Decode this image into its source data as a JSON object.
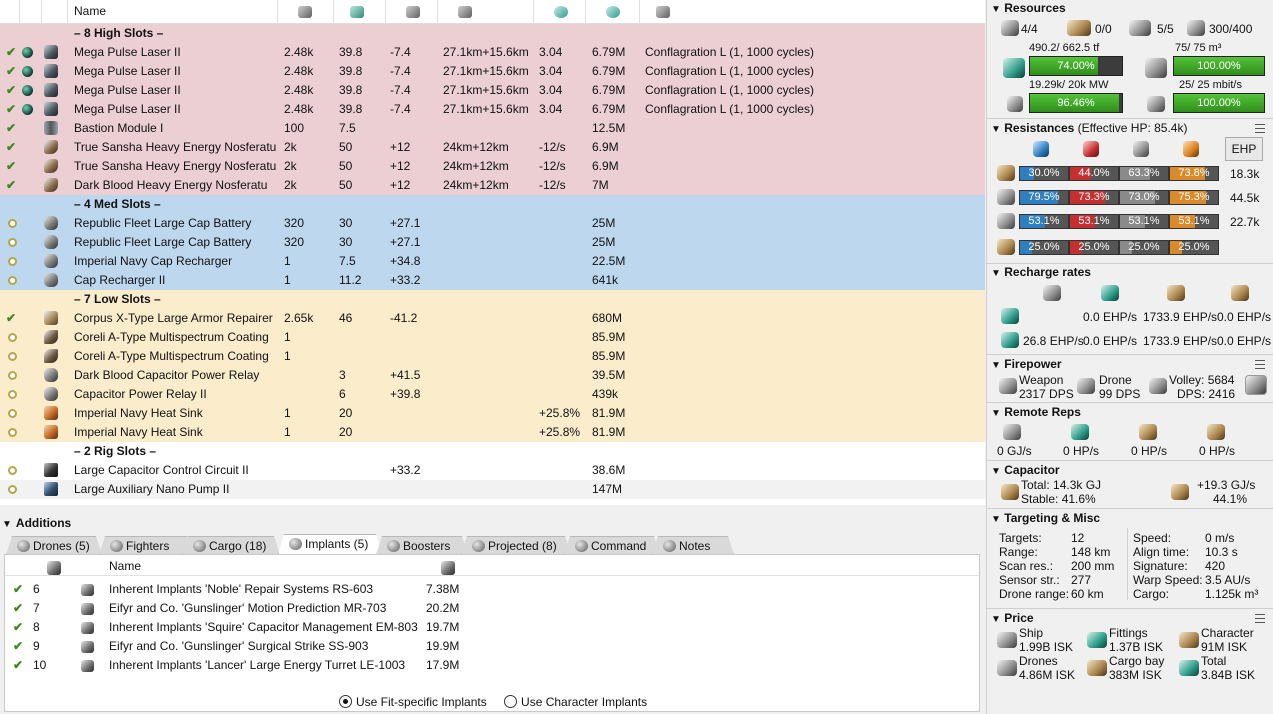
{
  "fitting": {
    "name_header": "Name",
    "sections": {
      "high": "– 8 High Slots –",
      "med": "– 4 Med Slots –",
      "low": "– 7 Low Slots –",
      "rig": "– 2 Rig Slots –"
    },
    "rows": [
      {
        "name": "Mega Pulse Laser II",
        "cpu": "2.48k",
        "pg": "39.8",
        "cap": "-7.4",
        "range": "27.1km+15.6km",
        "dps": "3.04",
        "price": "6.79M",
        "ammo": "Conflagration L (1, 1000 cycles)"
      },
      {
        "name": "Mega Pulse Laser II",
        "cpu": "2.48k",
        "pg": "39.8",
        "cap": "-7.4",
        "range": "27.1km+15.6km",
        "dps": "3.04",
        "price": "6.79M",
        "ammo": "Conflagration L (1, 1000 cycles)"
      },
      {
        "name": "Mega Pulse Laser II",
        "cpu": "2.48k",
        "pg": "39.8",
        "cap": "-7.4",
        "range": "27.1km+15.6km",
        "dps": "3.04",
        "price": "6.79M",
        "ammo": "Conflagration L (1, 1000 cycles)"
      },
      {
        "name": "Mega Pulse Laser II",
        "cpu": "2.48k",
        "pg": "39.8",
        "cap": "-7.4",
        "range": "27.1km+15.6km",
        "dps": "3.04",
        "price": "6.79M",
        "ammo": "Conflagration L (1, 1000 cycles)"
      },
      {
        "name": "Bastion Module I",
        "cpu": "100",
        "pg": "7.5",
        "cap": "",
        "range": "",
        "dps": "",
        "price": "12.5M",
        "ammo": ""
      },
      {
        "name": "True Sansha Heavy Energy Nosferatu",
        "cpu": "2k",
        "pg": "50",
        "cap": "+12",
        "range": "24km+12km",
        "dps": "-12/s",
        "price": "6.9M",
        "ammo": ""
      },
      {
        "name": "True Sansha Heavy Energy Nosferatu",
        "cpu": "2k",
        "pg": "50",
        "cap": "+12",
        "range": "24km+12km",
        "dps": "-12/s",
        "price": "6.9M",
        "ammo": ""
      },
      {
        "name": "Dark Blood Heavy Energy Nosferatu",
        "cpu": "2k",
        "pg": "50",
        "cap": "+12",
        "range": "24km+12km",
        "dps": "-12/s",
        "price": "7M",
        "ammo": ""
      },
      {
        "name": "Republic Fleet Large Cap Battery",
        "cpu": "320",
        "pg": "30",
        "cap": "+27.1",
        "range": "",
        "dps": "",
        "price": "25M",
        "ammo": ""
      },
      {
        "name": "Republic Fleet Large Cap Battery",
        "cpu": "320",
        "pg": "30",
        "cap": "+27.1",
        "range": "",
        "dps": "",
        "price": "25M",
        "ammo": ""
      },
      {
        "name": "Imperial Navy Cap Recharger",
        "cpu": "1",
        "pg": "7.5",
        "cap": "+34.8",
        "range": "",
        "dps": "",
        "price": "22.5M",
        "ammo": ""
      },
      {
        "name": "Cap Recharger II",
        "cpu": "1",
        "pg": "11.2",
        "cap": "+33.2",
        "range": "",
        "dps": "",
        "price": "641k",
        "ammo": ""
      },
      {
        "name": "Corpus X-Type Large Armor Repairer",
        "cpu": "2.65k",
        "pg": "46",
        "cap": "-41.2",
        "range": "",
        "dps": "",
        "price": "680M",
        "ammo": ""
      },
      {
        "name": "Coreli A-Type Multispectrum Coating",
        "cpu": "1",
        "pg": "",
        "cap": "",
        "range": "",
        "dps": "",
        "price": "85.9M",
        "ammo": ""
      },
      {
        "name": "Coreli A-Type Multispectrum Coating",
        "cpu": "1",
        "pg": "",
        "cap": "",
        "range": "",
        "dps": "",
        "price": "85.9M",
        "ammo": ""
      },
      {
        "name": "Dark Blood Capacitor Power Relay",
        "cpu": "",
        "pg": "3",
        "cap": "+41.5",
        "range": "",
        "dps": "",
        "price": "39.5M",
        "ammo": ""
      },
      {
        "name": "Capacitor Power Relay II",
        "cpu": "",
        "pg": "6",
        "cap": "+39.8",
        "range": "",
        "dps": "",
        "price": "439k",
        "ammo": ""
      },
      {
        "name": "Imperial Navy Heat Sink",
        "cpu": "1",
        "pg": "20",
        "cap": "",
        "range": "",
        "dps": "+25.8%",
        "price": "81.9M",
        "ammo": ""
      },
      {
        "name": "Imperial Navy Heat Sink",
        "cpu": "1",
        "pg": "20",
        "cap": "",
        "range": "",
        "dps": "+25.8%",
        "price": "81.9M",
        "ammo": ""
      },
      {
        "name": "Large Capacitor Control Circuit II",
        "cpu": "",
        "pg": "",
        "cap": "+33.2",
        "range": "",
        "dps": "",
        "price": "38.6M",
        "ammo": ""
      },
      {
        "name": "Large Auxiliary Nano Pump II",
        "cpu": "",
        "pg": "",
        "cap": "",
        "range": "",
        "dps": "",
        "price": "147M",
        "ammo": ""
      }
    ]
  },
  "additions": {
    "title": "Additions",
    "tabs": [
      "Drones (5)",
      "Fighters",
      "Cargo (18)",
      "Implants (5)",
      "Boosters",
      "Projected (8)",
      "Command",
      "Notes"
    ],
    "name_header": "Name",
    "implants": [
      {
        "slot": "6",
        "name": "Inherent Implants 'Noble' Repair Systems RS-603",
        "price": "7.38M"
      },
      {
        "slot": "7",
        "name": "Eifyr and Co. 'Gunslinger' Motion Prediction MR-703",
        "price": "20.2M"
      },
      {
        "slot": "8",
        "name": "Inherent Implants 'Squire' Capacitor Management EM-803",
        "price": "19.7M"
      },
      {
        "slot": "9",
        "name": "Eifyr and Co. 'Gunslinger' Surgical Strike SS-903",
        "price": "19.9M"
      },
      {
        "slot": "10",
        "name": "Inherent Implants 'Lancer' Large Energy Turret LE-1003",
        "price": "17.9M"
      }
    ],
    "radio_fit": "Use Fit-specific Implants",
    "radio_char": "Use Character Implants",
    "radio_selected": "fit"
  },
  "resources": {
    "title": "Resources",
    "turrets": "4/4",
    "launchers": "0/0",
    "drones_active": "5/5",
    "calibration": "300/400",
    "cpu_text": "490.2/ 662.5 tf",
    "cpu_pct": "74.00%",
    "cpu_level": 0.74,
    "drone_bay_text": "75/ 75 m³",
    "drone_bay_pct": "100.00%",
    "drone_bay_level": 1.0,
    "pg_text": "19.29k/ 20k MW",
    "pg_pct": "96.46%",
    "pg_level": 0.9646,
    "bandwidth_text": "25/ 25 mbit/s",
    "bandwidth_pct": "100.00%",
    "bandwidth_level": 1.0
  },
  "resistances": {
    "title": "Resistances",
    "subtitle": "(Effective HP: 85.4k)",
    "ehp_button": "EHP",
    "colors": {
      "em": "#2f7fc0",
      "thermal": "#c43030",
      "kinetic": "#8a8a8a",
      "explosive": "#d98a2a"
    },
    "rows": [
      {
        "layer": "shield",
        "em": "30.0%",
        "th": "44.0%",
        "ki": "63.3%",
        "ex": "73.8%",
        "em_level": 0.3,
        "th_level": 0.44,
        "ki_level": 0.633,
        "ex_level": 0.738,
        "ehp": "18.3k"
      },
      {
        "layer": "armor",
        "em": "79.5%",
        "th": "73.3%",
        "ki": "73.0%",
        "ex": "75.3%",
        "em_level": 0.795,
        "th_level": 0.733,
        "ki_level": 0.73,
        "ex_level": 0.753,
        "ehp": "44.5k"
      },
      {
        "layer": "hull",
        "em": "53.1%",
        "th": "53.1%",
        "ki": "53.1%",
        "ex": "53.1%",
        "em_level": 0.531,
        "th_level": 0.531,
        "ki_level": 0.531,
        "ex_level": 0.531,
        "ehp": "22.7k"
      },
      {
        "layer": "damage-pattern",
        "em": "25.0%",
        "th": "25.0%",
        "ki": "25.0%",
        "ex": "25.0%",
        "em_level": 0.25,
        "th_level": 0.25,
        "ki_level": 0.25,
        "ex_level": 0.25,
        "ehp": ""
      }
    ]
  },
  "recharge": {
    "title": "Recharge rates",
    "row1": [
      "0.0 EHP/s",
      "1733.9 EHP/s",
      "0.0 EHP/s"
    ],
    "row2": [
      "26.8 EHP/s",
      "0.0 EHP/s",
      "1733.9 EHP/s",
      "0.0 EHP/s"
    ]
  },
  "firepower": {
    "title": "Firepower",
    "weapon_label": "Weapon",
    "weapon_dps": "2317 DPS",
    "drone_label": "Drone",
    "drone_dps": "99 DPS",
    "volley": "Volley: 5684",
    "dps_total": "DPS: 2416"
  },
  "remote_reps": {
    "title": "Remote Reps",
    "values": [
      "0 GJ/s",
      "0 HP/s",
      "0 HP/s",
      "0 HP/s"
    ]
  },
  "capacitor": {
    "title": "Capacitor",
    "total": "Total: 14.3k GJ",
    "stable": "Stable: 41.6%",
    "rate": "+19.3 GJ/s",
    "rate_pct": "44.1%"
  },
  "targeting": {
    "title": "Targeting & Misc",
    "left_labels": [
      "Targets:",
      "Range:",
      "Scan res.:",
      "Sensor str.:",
      "Drone range:"
    ],
    "left_values": [
      "12",
      "148 km",
      "200 mm",
      "277",
      "60 km"
    ],
    "right_labels": [
      "Speed:",
      "Align time:",
      "Signature:",
      "Warp Speed:",
      "Cargo:"
    ],
    "right_values": [
      "0 m/s",
      "10.3 s",
      "420",
      "3.5 AU/s",
      "1.125k m³"
    ]
  },
  "price": {
    "title": "Price",
    "ship_label": "Ship",
    "ship_value": "1.99B ISK",
    "fittings_label": "Fittings",
    "fittings_value": "1.37B ISK",
    "character_label": "Character",
    "character_value": "91M ISK",
    "drones_label": "Drones",
    "drones_value": "4.86M ISK",
    "cargo_label": "Cargo bay",
    "cargo_value": "383M ISK",
    "total_label": "Total",
    "total_value": "3.84B ISK"
  }
}
